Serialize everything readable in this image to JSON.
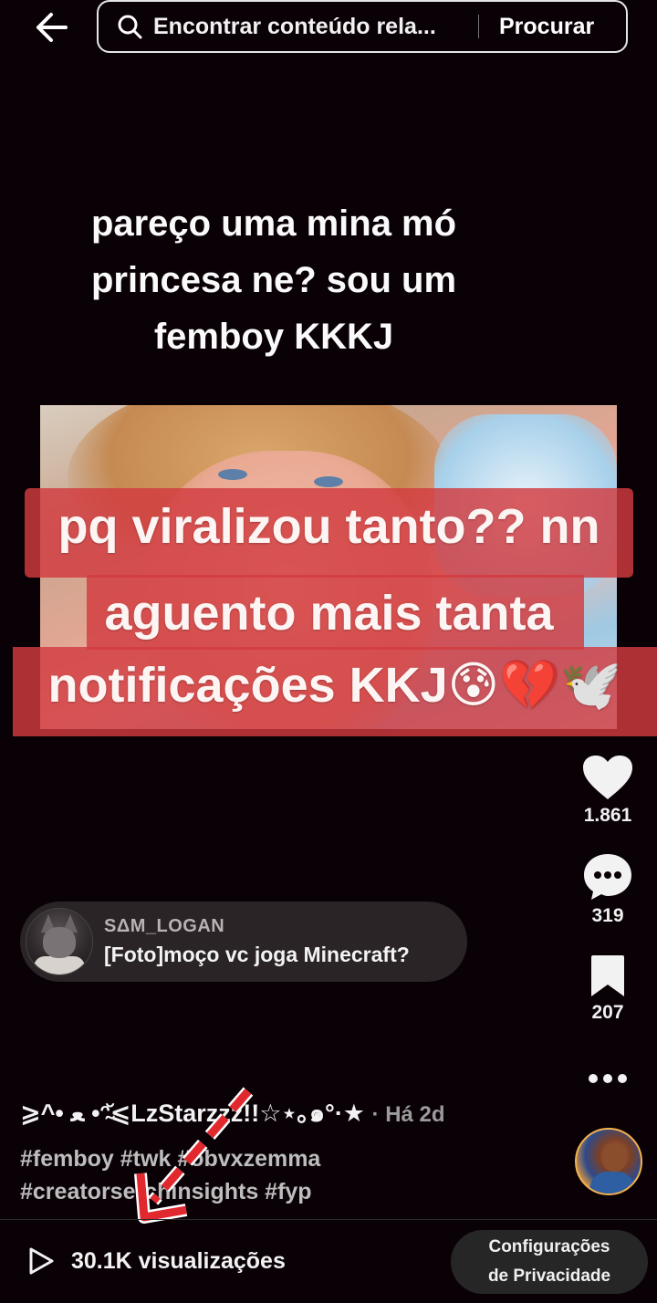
{
  "search": {
    "query": "Encontrar conteúdo rela...",
    "button_label": "Procurar"
  },
  "video": {
    "top_caption_lines": [
      "pareço uma mina mó",
      "princesa ne? sou um",
      "femboy KKKJ"
    ],
    "overlay_lines": [
      "pq viralizou tanto?? nn",
      "aguento mais tanta",
      "notificações KKJ😰💔🕊️"
    ]
  },
  "actions": {
    "likes": "1.861",
    "comments": "319",
    "saves": "207"
  },
  "comment": {
    "username": "SΔM_LOGAN",
    "text": "[Foto]moço vc joga Minecraft?"
  },
  "post": {
    "author": "⩾^• ﻌ •ᵔ̴̆⩽LzStarzzz!!☆⋆｡๑°·★",
    "time": "· Há 2d",
    "hashtags_line1": [
      "#femboy",
      "#tw​k",
      "#obvxzemma"
    ],
    "hashtags_line2": [
      "#creatorse​rchinsights",
      "#fyp"
    ]
  },
  "bottom": {
    "views": "30.1K visualizações",
    "privacy_line1": "Configurações",
    "privacy_line2": "de Privacidade"
  },
  "colors": {
    "background": "#0a0106",
    "overlay_band": "#d23a40",
    "annotation_red": "#e0282e"
  },
  "icons": [
    "back-arrow-icon",
    "search-icon",
    "heart-icon",
    "comment-icon",
    "bookmark-icon",
    "more-icon",
    "play-icon"
  ]
}
